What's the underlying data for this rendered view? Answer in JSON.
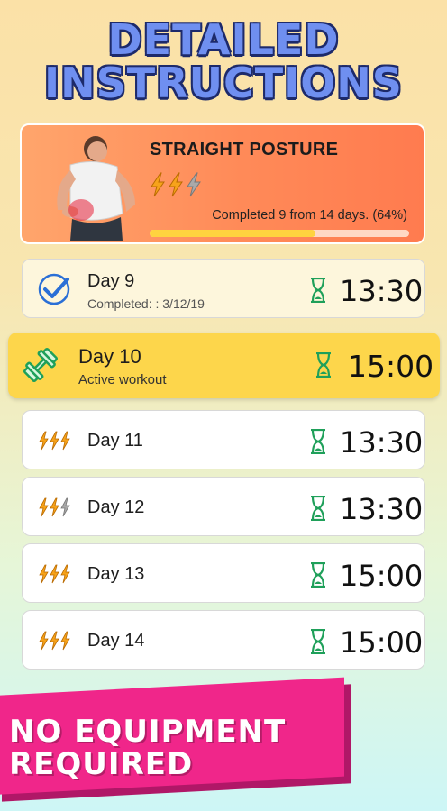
{
  "headline": {
    "line1": "DETAILED",
    "line2": "INSTRUCTIONS"
  },
  "program": {
    "title": "STRAIGHT POSTURE",
    "difficulty_level": 2,
    "difficulty_max": 3,
    "progress_text": "Completed 9 from 14 days. (64%)",
    "progress_fraction": 0.64
  },
  "days": [
    {
      "label": "Day 9",
      "sub": "Completed: : 3/12/19",
      "time": "13:30",
      "state": "completed",
      "icon": "checkmark-icon"
    },
    {
      "label": "Day 10",
      "sub": "Active workout",
      "time": "15:00",
      "state": "active",
      "icon": "dumbbell-icon"
    },
    {
      "label": "Day 11",
      "time": "13:30",
      "state": "upcoming",
      "level": 3,
      "icon": "bolt-icon"
    },
    {
      "label": "Day 12",
      "time": "13:30",
      "state": "upcoming",
      "level": 2,
      "icon": "bolt-icon"
    },
    {
      "label": "Day 13",
      "time": "15:00",
      "state": "upcoming",
      "level": 3,
      "icon": "bolt-icon"
    },
    {
      "label": "Day 14",
      "time": "15:00",
      "state": "upcoming",
      "level": 3,
      "icon": "bolt-icon"
    }
  ],
  "banner": {
    "line1": "NO EQUIPMENT",
    "line2": "REQUIRED"
  },
  "colors": {
    "accent_orange": "#ff8a58",
    "active_yellow": "#fdd64b",
    "hourglass_green": "#1fa05a",
    "check_blue": "#2a6fd6",
    "banner_pink": "#f0268a",
    "headline_blue": "#6f8ff0"
  }
}
